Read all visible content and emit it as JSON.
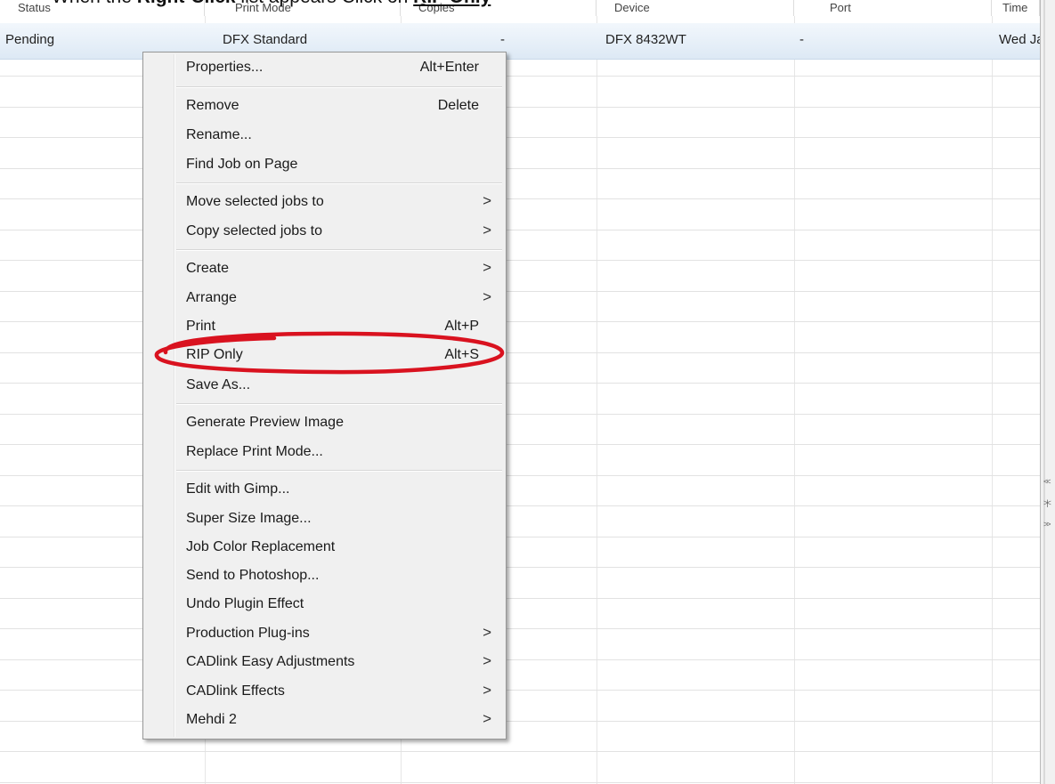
{
  "instruction": {
    "prefix": "When the ",
    "bold": "Right-Click",
    "middle": " list appears Click on ",
    "link": "RIP Only"
  },
  "table": {
    "columns": [
      "Status",
      "Print Mode",
      "Copies",
      "Device",
      "Port",
      "Time"
    ],
    "selected_row": {
      "status": "Pending",
      "print_mode": "DFX Standard",
      "copies": "-",
      "device": "DFX 8432WT",
      "port": "-",
      "time": "Wed Ja"
    }
  },
  "context_menu": {
    "items": [
      {
        "label": "Properties...",
        "shortcut": "Alt+Enter"
      },
      {
        "label": "Remove",
        "shortcut": "Delete"
      },
      {
        "label": "Rename..."
      },
      {
        "label": "Find Job on Page"
      },
      {
        "label": "Move selected jobs to",
        "submenu": ">"
      },
      {
        "label": "Copy selected jobs to",
        "submenu": ">"
      },
      {
        "label": "Create",
        "submenu": ">"
      },
      {
        "label": "Arrange",
        "submenu": ">"
      },
      {
        "label": "Print",
        "shortcut": "Alt+P"
      },
      {
        "label": "RIP Only",
        "shortcut": "Alt+S"
      },
      {
        "label": "Save As..."
      },
      {
        "label": "Generate Preview Image"
      },
      {
        "label": "Replace Print Mode..."
      },
      {
        "label": "Edit with Gimp..."
      },
      {
        "label": "Super Size Image..."
      },
      {
        "label": "Job Color Replacement"
      },
      {
        "label": "Send to Photoshop..."
      },
      {
        "label": "Undo Plugin Effect"
      },
      {
        "label": "Production Plug-ins",
        "submenu": ">"
      },
      {
        "label": "CADlink Easy Adjustments",
        "submenu": ">"
      },
      {
        "label": "CADlink Effects",
        "submenu": ">"
      },
      {
        "label": "Mehdi 2",
        "submenu": ">"
      }
    ]
  },
  "side_nav": {
    "arrows": [
      "<<",
      ">|<",
      ">>"
    ]
  },
  "colors": {
    "highlight_ellipse": "#d9121f",
    "selected_row": "#dde9f5"
  }
}
